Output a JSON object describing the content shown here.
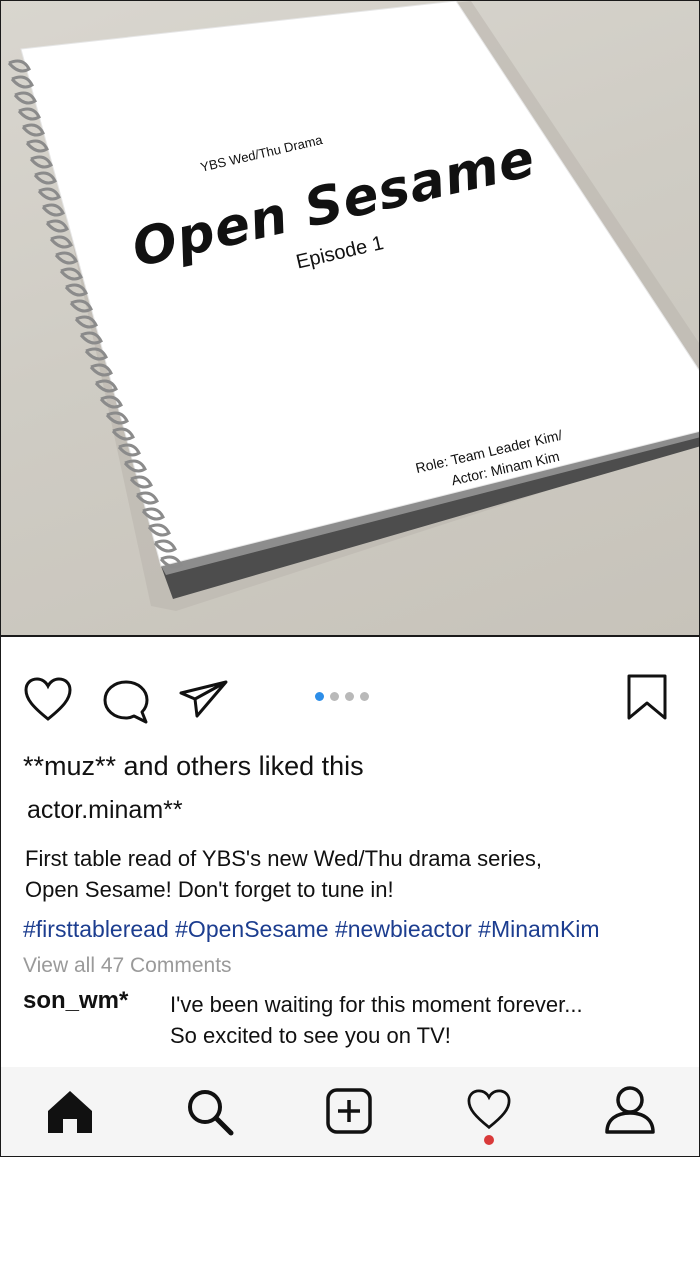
{
  "post_image": {
    "network": "YBS Wed/Thu Drama",
    "title": "Open Sesame",
    "episode": "Episode 1",
    "role": "Role: Team Leader Kim/",
    "actor": "Actor: Minam Kim"
  },
  "actions": {
    "like_icon": "heart-outline-icon",
    "comment_icon": "speech-bubble-icon",
    "share_icon": "paper-plane-icon",
    "save_icon": "bookmark-icon",
    "carousel": {
      "total": 4,
      "active_index": 0
    },
    "accent_color": "#2d8ee8"
  },
  "post": {
    "likes_text": "**muz** and others liked this",
    "author": "actor.minam**",
    "caption_line1": "First table read of YBS's new Wed/Thu drama series,",
    "caption_line2": "Open Sesame! Don't forget to tune in!",
    "hashtags": "#firsttableread #OpenSesame #newbieactor #MinamKim",
    "view_all": "View all 47 Comments",
    "hashtag_color": "#1c3d8f"
  },
  "comment": {
    "user": "son_wm*",
    "line1": "I've been waiting for this moment forever...",
    "line2": "So excited to see you on TV!"
  },
  "bottom_nav": {
    "items": [
      "home-icon",
      "search-icon",
      "add-post-icon",
      "activity-heart-icon",
      "profile-icon"
    ],
    "notification_color": "#d93a3a"
  }
}
